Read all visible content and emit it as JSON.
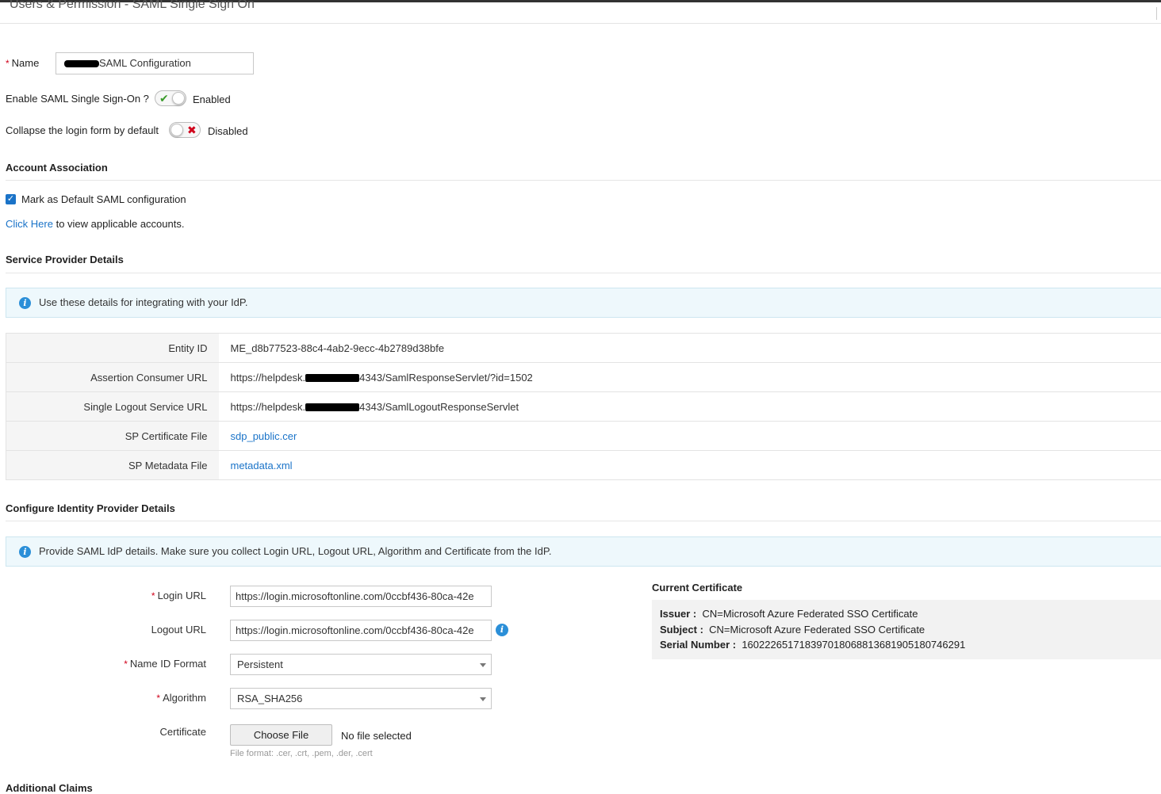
{
  "window": {
    "title": "Users & Permission - SAML Single Sign On"
  },
  "form": {
    "name_label": "Name",
    "name_value": "SAML Configuration",
    "enable_label": "Enable SAML Single Sign-On ?",
    "enable_state": "Enabled",
    "collapse_label": "Collapse the login form by default",
    "collapse_state": "Disabled"
  },
  "account_association": {
    "title": "Account Association",
    "default_label": "Mark as Default SAML configuration",
    "default_checked": true,
    "click_here": "Click Here",
    "click_here_suffix": "to view applicable accounts."
  },
  "service_provider": {
    "title": "Service Provider Details",
    "info": "Use these details for integrating with your IdP.",
    "rows": [
      {
        "label": "Entity ID",
        "value": "ME_d8b77523-88c4-4ab2-9ecc-4b2789d38bfe"
      },
      {
        "label": "Assertion Consumer URL",
        "prefix": "https://helpdesk.",
        "suffix": "4343/SamlResponseServlet/?id=1502"
      },
      {
        "label": "Single Logout Service URL",
        "prefix": "https://helpdesk.",
        "suffix": "4343/SamlLogoutResponseServlet"
      },
      {
        "label": "SP Certificate File",
        "value": "sdp_public.cer"
      },
      {
        "label": "SP Metadata File",
        "value": "metadata.xml"
      }
    ]
  },
  "identity_provider": {
    "title": "Configure Identity Provider Details",
    "info": "Provide SAML IdP details. Make sure you collect Login URL, Logout URL, Algorithm and Certificate from the IdP.",
    "login_url_label": "Login URL",
    "login_url_value": "https://login.microsoftonline.com/0ccbf436-80ca-42e",
    "logout_url_label": "Logout URL",
    "logout_url_value": "https://login.microsoftonline.com/0ccbf436-80ca-42e",
    "name_id_label": "Name ID Format",
    "name_id_value": "Persistent",
    "algorithm_label": "Algorithm",
    "algorithm_value": "RSA_SHA256",
    "certificate_label": "Certificate",
    "choose_file": "Choose File",
    "no_file": "No file selected",
    "file_hint": "File format: .cer, .crt, .pem, .der, .cert"
  },
  "current_certificate": {
    "title": "Current Certificate",
    "issuer_label": "Issuer :",
    "issuer_value": "CN=Microsoft Azure Federated SSO Certificate",
    "subject_label": "Subject :",
    "subject_value": "CN=Microsoft Azure Federated SSO Certificate",
    "serial_label": "Serial Number :",
    "serial_value": "160222651718397018068813681905180746291"
  },
  "additional_claims": {
    "title": "Additional Claims"
  },
  "colors": {
    "link": "#1a73c8",
    "required": "#d0021b",
    "info_bg": "#eef8fc",
    "check_green": "#3a9b2a",
    "cross_red": "#d0021b"
  }
}
